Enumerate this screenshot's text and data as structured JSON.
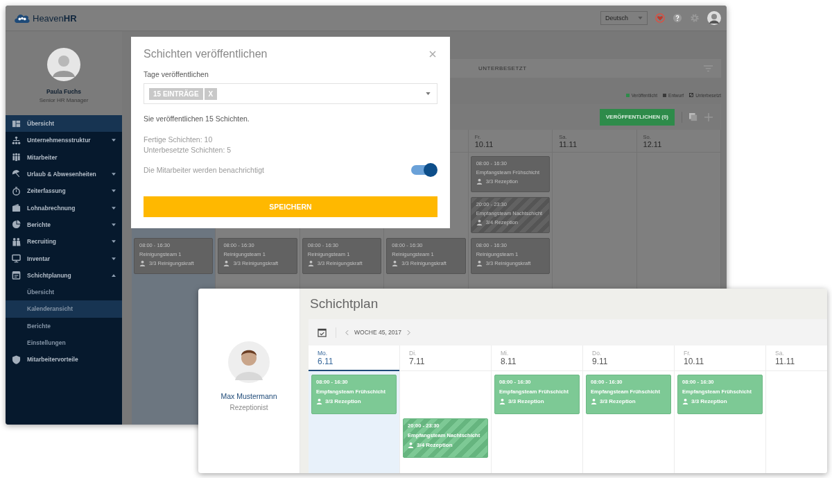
{
  "background_window": {
    "logo": "Heaven**HR**",
    "language": "Deutsch",
    "sidebar": {
      "user": {
        "name": "Paula Fuchs",
        "role": "Senior HR Manager"
      },
      "items": [
        {
          "label": "Übersicht",
          "kind": "link",
          "selected": true,
          "expanded": false
        },
        {
          "label": "Unternehmensstruktur",
          "kind": "menu",
          "selected": false,
          "expanded": false
        },
        {
          "label": "Mitarbeiter",
          "kind": "link",
          "selected": false,
          "expanded": false
        },
        {
          "label": "Urlaub & Abwesenheiten",
          "kind": "menu",
          "selected": false,
          "expanded": false
        },
        {
          "label": "Zeiterfassung",
          "kind": "menu",
          "selected": false,
          "expanded": false
        },
        {
          "label": "Lohnabrechnung",
          "kind": "menu",
          "selected": false,
          "expanded": false
        },
        {
          "label": "Berichte",
          "kind": "menu",
          "selected": false,
          "expanded": false
        },
        {
          "label": "Recruiting",
          "kind": "menu",
          "selected": false,
          "expanded": false
        },
        {
          "label": "Inventar",
          "kind": "menu",
          "selected": false,
          "expanded": false
        },
        {
          "label": "Schichtplanung",
          "kind": "menu",
          "selected": false,
          "expanded": true,
          "children": [
            {
              "label": "Übersicht",
              "selected": false
            },
            {
              "label": "Kalenderansicht",
              "selected": true
            },
            {
              "label": "Berichte",
              "selected": false
            },
            {
              "label": "Einstellungen",
              "selected": false
            }
          ]
        },
        {
          "label": "Mitarbeitervorteile",
          "kind": "link",
          "selected": false,
          "expanded": false
        }
      ]
    },
    "tabs": [
      {
        "label": "UNTERBESETZT",
        "selected": false
      }
    ],
    "legend": [
      {
        "label": "Veröffentlicht",
        "kind": "solid",
        "color": "#2e8b4a"
      },
      {
        "label": "Entwurf",
        "kind": "solid",
        "color": "#3a3a3a"
      },
      {
        "label": "Unterbesetzt",
        "kind": "hatched"
      }
    ],
    "publish_button": "VERÖFFENTLICHEN (0)",
    "calendar": {
      "days": [
        {
          "selected": true,
          "shifts": [
            {
              "kind": "cleaning",
              "time": "08:00 - 16:30",
              "team": "Reinigungsteam 1",
              "staffing": "3/3 Reinigungskraft",
              "understaffed": false
            }
          ]
        },
        {
          "selected": false,
          "shifts": [
            {
              "kind": "cleaning",
              "time": "08:00 - 16:30",
              "team": "Reinigungsteam 1",
              "staffing": "3/3 Reinigungskraft",
              "understaffed": false
            }
          ]
        },
        {
          "selected": false,
          "shifts": [
            {
              "kind": "cleaning",
              "time": "08:00 - 16:30",
              "team": "Reinigungsteam 1",
              "staffing": "3/3 Reinigungskraft",
              "understaffed": false
            }
          ]
        },
        {
          "selected": false,
          "shifts": [
            {
              "kind": "cleaning",
              "time": "08:00 - 16:30",
              "team": "Reinigungsteam 1",
              "staffing": "3/3 Reinigungskraft",
              "understaffed": false
            }
          ]
        },
        {
          "day": "Fr.",
          "date": "10.11",
          "selected": false,
          "shifts": [
            {
              "kind": "early",
              "time": "08:00 - 16:30",
              "team": "Empfangsteam Frühschicht",
              "staffing": "3/3 Rezeption",
              "understaffed": false
            },
            {
              "kind": "night",
              "time": "20:00 - 23:30",
              "team": "Empfangsteam Nachtschicht",
              "staffing": "3/4 Rezeption",
              "understaffed": true
            },
            {
              "kind": "cleaning",
              "time": "08:00 - 16:30",
              "team": "Reinigungsteam 1",
              "staffing": "3/3 Reinigungskraft",
              "understaffed": false
            }
          ]
        },
        {
          "day": "Sa.",
          "date": "11.11",
          "selected": false
        },
        {
          "day": "So.",
          "date": "12.11",
          "selected": false
        }
      ]
    }
  },
  "publish_dialog": {
    "title": "Schichten veröffentlichen",
    "field_label": "Tage veröffentlichen",
    "tag": "15 EINTRÄGE",
    "tag_remove": "X",
    "summary": "Sie veröffentlichen 15 Schichten.",
    "stats": [
      "Fertige Schichten: 10",
      "Unterbesetzte Schichten: 5"
    ],
    "notify_label": "Die Mitarbeiter werden benachrichtigt",
    "notify_on": true,
    "save_button": "SPEICHERN"
  },
  "shift_plan_window": {
    "user": {
      "name": "Max Mustermann",
      "role": "Rezeptionist"
    },
    "title": "Schichtplan",
    "week": "WOCHE 45, 2017",
    "days": [
      {
        "day": "Mo.",
        "date": "6.11",
        "selected": true,
        "shifts": [
          {
            "kind": "early",
            "time": "08:00 - 16:30",
            "team": "Empfangsteam Frühschicht",
            "staffing": "3/3 Rezeption",
            "understaffed": false
          }
        ]
      },
      {
        "day": "Di.",
        "date": "7.11",
        "selected": false,
        "shifts": [
          {
            "kind": "night",
            "time": "20:00 - 23:30",
            "team": "Empfangsteam Nachtschicht",
            "staffing": "3/4 Rezeption",
            "understaffed": true
          }
        ]
      },
      {
        "day": "Mi.",
        "date": "8.11",
        "selected": false,
        "shifts": [
          {
            "kind": "early",
            "time": "08:00 - 16:30",
            "team": "Empfangsteam Frühschicht",
            "staffing": "3/3 Rezeption",
            "understaffed": false
          }
        ]
      },
      {
        "day": "Do.",
        "date": "9.11",
        "selected": false,
        "shifts": [
          {
            "kind": "early",
            "time": "08:00 - 16:30",
            "team": "Empfangsteam Frühschicht",
            "staffing": "3/3 Rezeption",
            "understaffed": false
          }
        ]
      },
      {
        "day": "Fr.",
        "date": "10.11",
        "selected": false,
        "shifts": [
          {
            "kind": "early",
            "time": "08:00 - 16:30",
            "team": "Empfangsteam Frühschicht",
            "staffing": "3/3 Rezeption",
            "understaffed": false
          }
        ]
      },
      {
        "day": "Sa.",
        "date": "11.11",
        "selected": false
      }
    ]
  }
}
